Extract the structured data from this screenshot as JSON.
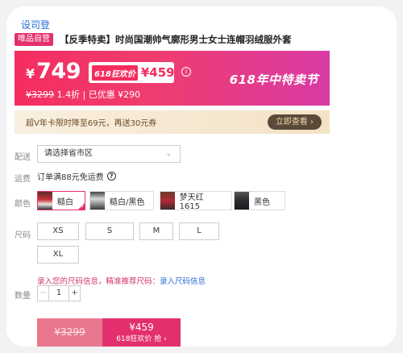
{
  "header": {
    "brand_link": "设司登"
  },
  "product": {
    "vip_badge": "唯品自营",
    "title": "【反季特卖】时尚国潮帅气廓形男士女士连帽羽绒服外套"
  },
  "price": {
    "currency": "¥",
    "current": "749",
    "promo_tag": "618狂欢价",
    "promo_price": "¥459",
    "info_icon": "i",
    "original": "¥3299",
    "discount_text": " 1.4折 | 已优惠 ¥290",
    "event_title": "618年中特卖节"
  },
  "vip_bar": {
    "text": "超V年卡限时降至69元，再送30元券",
    "button": "立即查看 ›"
  },
  "delivery": {
    "label": "配送",
    "select_value": "请选择省市区",
    "chevron": "⌄",
    "shipping_label": "运费",
    "shipping_text": "订单满88元免运费",
    "help_icon": "?"
  },
  "colors": {
    "label": "颜色",
    "options": [
      {
        "label": "糙白",
        "selected": true
      },
      {
        "label": "糙白/黑色",
        "selected": false
      },
      {
        "label": "梦天红1615",
        "selected": false
      },
      {
        "label": "黑色",
        "selected": false
      }
    ],
    "swatch_palette": [
      "#c8343b",
      "#3a3a3a",
      "#b02a35",
      "#2b2b30"
    ]
  },
  "sizes": {
    "label": "尺码",
    "options": [
      "XS",
      "S",
      "M",
      "L",
      "XL"
    ],
    "hint": "录入您的尺码信息，精准推荐尺码：",
    "hint_link": "录入尺码信息"
  },
  "quantity": {
    "label": "数量",
    "minus": "−",
    "value": "1",
    "plus": "+"
  },
  "buy": {
    "original_price": "¥3299",
    "promo_price": "¥459",
    "action_label": "618狂欢价 抢 ›"
  },
  "colors_theme": {
    "accent": "#e3306c",
    "link": "#2a6bd6"
  }
}
